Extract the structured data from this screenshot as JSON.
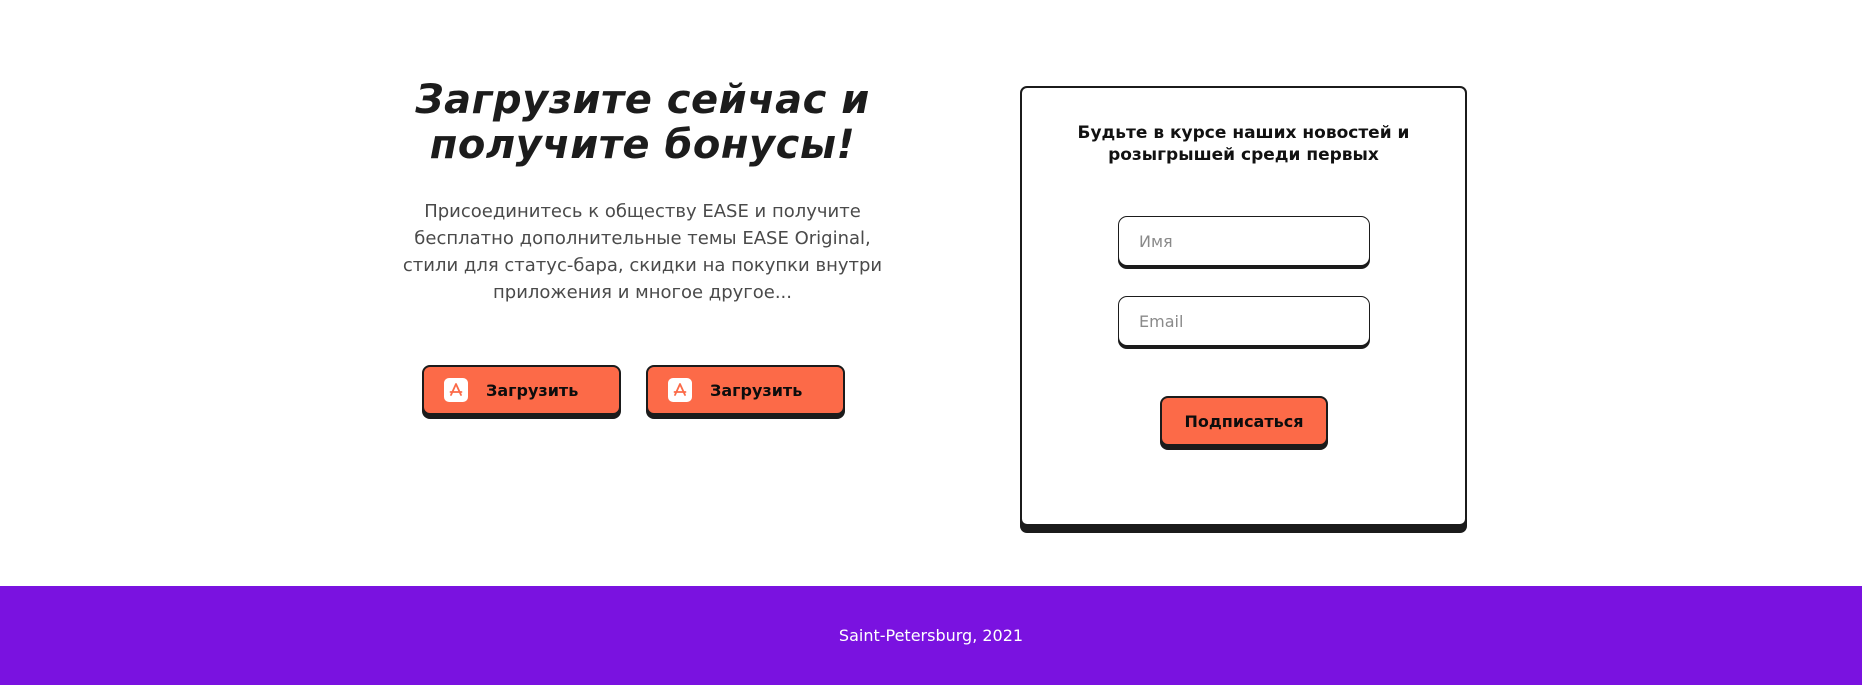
{
  "promo": {
    "headline_line1": "Загрузите сейчас и",
    "headline_line2": "получите бонусы!",
    "description": "Присоединитесь к обществу EASE и получите бесплатно дополнительные темы EASE Original, стили для статус-бара, скидки на покупки внутри приложения и многое другое...",
    "download_buttons": [
      {
        "label": "Загрузить",
        "icon": "app-store-icon"
      },
      {
        "label": "Загрузить",
        "icon": "app-store-icon"
      }
    ]
  },
  "subscribe": {
    "title": "Будьте в курсе наших новостей и розыгрышей среди первых",
    "name_placeholder": "Имя",
    "email_placeholder": "Email",
    "submit_label": "Подписаться"
  },
  "footer": {
    "text": "Saint-Petersburg, 2021"
  },
  "colors": {
    "accent": "#fc6a48",
    "footer_bg": "#7a12e0",
    "outline": "#1b1b1b"
  }
}
